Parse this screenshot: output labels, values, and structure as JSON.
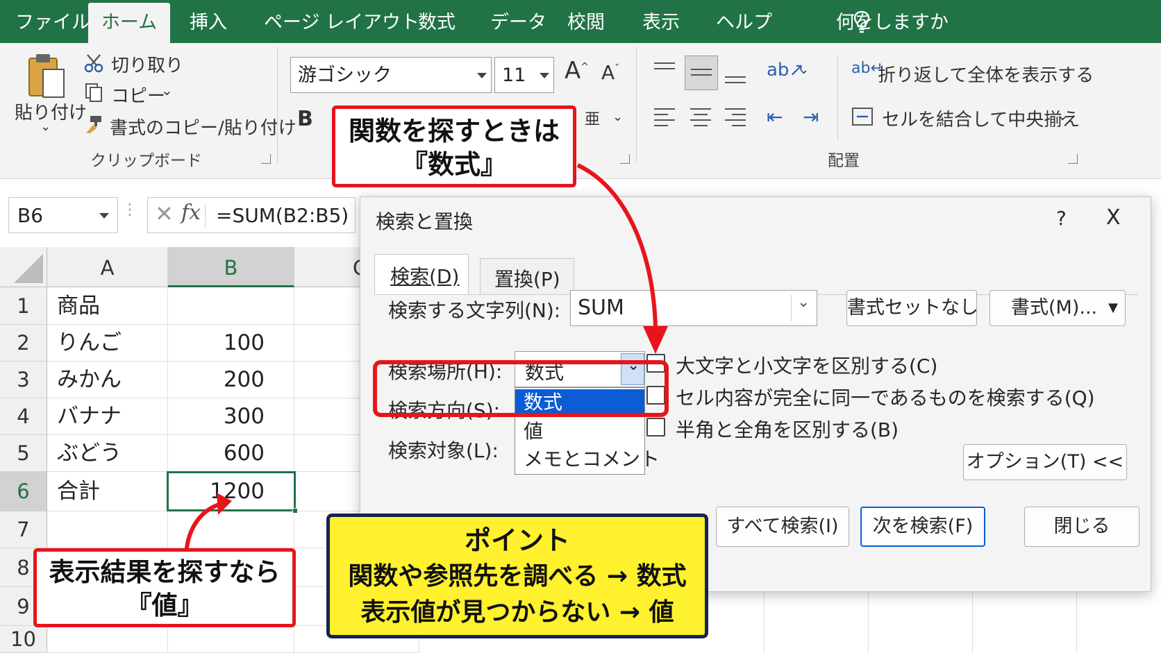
{
  "tabs": [
    "ファイル",
    "ホーム",
    "挿入",
    "ページ レイアウト",
    "数式",
    "データ",
    "校閲",
    "表示",
    "ヘルプ"
  ],
  "tell_me": "何をしますか",
  "clipboard": {
    "paste": "貼り付け",
    "cut": "切り取り",
    "copy": "コピー",
    "format_painter": "書式のコピー/貼り付け",
    "group_label": "クリップボード"
  },
  "font": {
    "name": "游ゴシック",
    "size": "11"
  },
  "alignment": {
    "wrap_text": "折り返して全体を表示する",
    "merge_center": "セルを結合して中央揃え",
    "group_label": "配置"
  },
  "formula_bar": {
    "name_box": "B6",
    "formula": "=SUM(B2:B5)"
  },
  "sheet": {
    "columns": [
      "A",
      "B",
      "C"
    ],
    "rows": [
      {
        "num": "1",
        "a": "商品",
        "b": ""
      },
      {
        "num": "2",
        "a": "りんご",
        "b": "100"
      },
      {
        "num": "3",
        "a": "みかん",
        "b": "200"
      },
      {
        "num": "4",
        "a": "バナナ",
        "b": "300"
      },
      {
        "num": "5",
        "a": "ぶどう",
        "b": "600"
      },
      {
        "num": "6",
        "a": "合計",
        "b": "1200"
      },
      {
        "num": "7",
        "a": "",
        "b": ""
      },
      {
        "num": "8",
        "a": "",
        "b": ""
      },
      {
        "num": "9",
        "a": "",
        "b": ""
      },
      {
        "num": "10",
        "a": "",
        "b": ""
      }
    ]
  },
  "dialog": {
    "title": "検索と置換",
    "help": "?",
    "close_x": "X",
    "tab_find": "検索(D)",
    "tab_replace": "置換(P)",
    "find_label": "検索する文字列(N):",
    "find_value": "SUM",
    "no_format_button": "書式セットなし",
    "format_button": "書式(M)...",
    "within_label": "検索場所(H):",
    "within_value": "数式",
    "within_options": [
      "数式",
      "値",
      "メモとコメント"
    ],
    "search_label": "検索方向(S):",
    "lookin_label": "検索対象(L):",
    "match_case": "大文字と小文字を区別する(C)",
    "match_entire": "セル内容が完全に同一であるものを検索する(Q)",
    "match_byte": "半角と全角を区別する(B)",
    "options_button": "オプション(T) <<",
    "find_all_button": "すべて検索(I)",
    "find_next_button": "次を検索(F)",
    "close_button": "閉じる"
  },
  "callouts": {
    "formula_line1": "関数を探すときは",
    "formula_line2": "『数式』",
    "value_line1": "表示結果を探すなら",
    "value_line2": "『値』",
    "point_title": "ポイント",
    "point_line1": "関数や参照先を調べる → 数式",
    "point_line2": "表示値が見つからない → 値"
  },
  "colors": {
    "excel_green": "#217346",
    "accent_blue": "#0b5cd5",
    "callout_red": "#e8141c",
    "callout_yellow": "#fff12e",
    "callout_navy": "#16244f"
  }
}
